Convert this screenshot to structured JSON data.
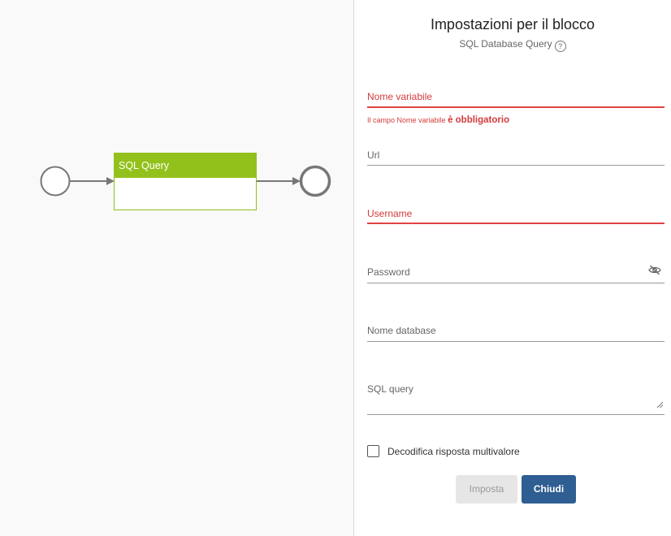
{
  "canvas": {
    "block": {
      "title": "SQL Query"
    }
  },
  "panel": {
    "title": "Impostazioni per il blocco",
    "subtitle": "SQL Database Query",
    "help_glyph": "?",
    "fields": {
      "variable_name": {
        "label": "Nome variabile",
        "value": ""
      },
      "variable_error": {
        "prefix": "Il campo Nome variabile",
        "emphasis": "è obbligatorio"
      },
      "url": {
        "label": "Url",
        "value": ""
      },
      "username": {
        "label": "Username",
        "value": ""
      },
      "password": {
        "label": "Password",
        "value": "",
        "toggle_icon": "eye-off-icon"
      },
      "database_name": {
        "label": "Nome database",
        "value": ""
      },
      "sql_query": {
        "label": "SQL query",
        "value": ""
      }
    },
    "checkbox": {
      "label": "Decodifica risposta multivalore",
      "checked": false
    },
    "buttons": {
      "set": "Imposta",
      "close": "Chiudi"
    }
  },
  "colors": {
    "block_header": "#93c11b",
    "error": "#d43b3b",
    "primary_button": "#2e5e92",
    "disabled_button": "#e6e6e6"
  }
}
